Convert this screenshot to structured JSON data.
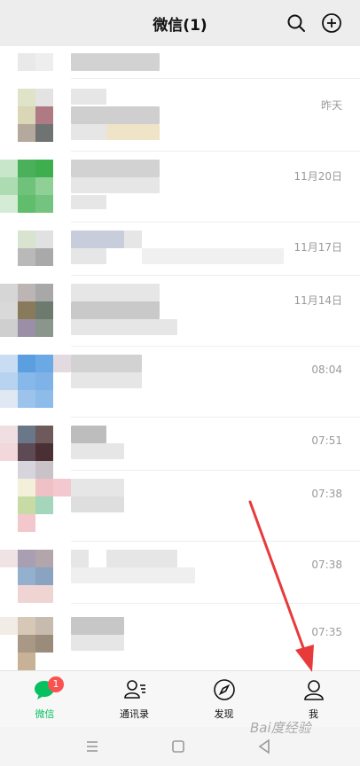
{
  "header": {
    "title": "微信(1)",
    "search_icon": "search-icon",
    "add_icon": "plus-circle-icon"
  },
  "chats": [
    {
      "time": ""
    },
    {
      "time": "昨天"
    },
    {
      "time": "11月20日"
    },
    {
      "time": "11月17日"
    },
    {
      "time": "11月14日"
    },
    {
      "time": "08:04"
    },
    {
      "time": "07:51"
    },
    {
      "time": "07:38"
    },
    {
      "time": "07:38"
    },
    {
      "time": "07:35"
    }
  ],
  "tabbar": {
    "tabs": [
      {
        "label": "微信",
        "icon": "chat-bubble-icon",
        "badge": "1",
        "active": true
      },
      {
        "label": "通讯录",
        "icon": "contacts-icon"
      },
      {
        "label": "发现",
        "icon": "compass-icon"
      },
      {
        "label": "我",
        "icon": "person-icon"
      }
    ]
  },
  "colors": {
    "accent": "#07c160",
    "badge": "#fa5151",
    "annotation_arrow": "#e83a3a"
  },
  "watermark": {
    "text": "Bai度经验"
  }
}
